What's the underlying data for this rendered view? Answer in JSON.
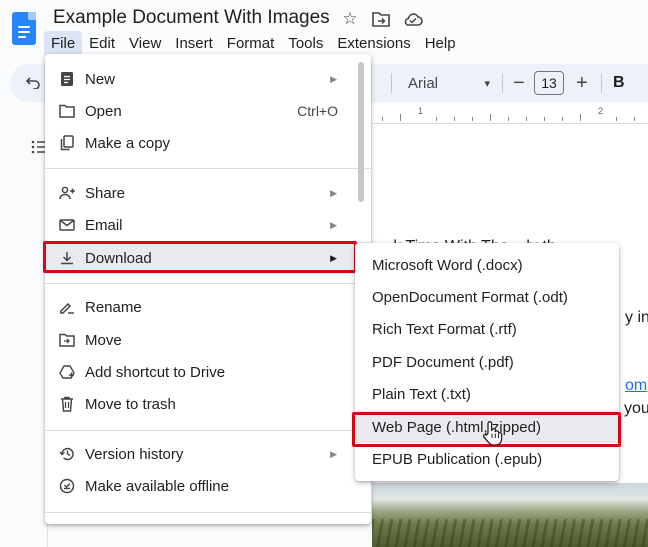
{
  "document": {
    "title": "Example Document With Images"
  },
  "menubar": [
    "File",
    "Edit",
    "View",
    "Insert",
    "Format",
    "Tools",
    "Extensions",
    "Help"
  ],
  "toolbar": {
    "font": "Arial",
    "font_size": "13",
    "minus": "−",
    "plus": "+",
    "bold": "B",
    "dropdown_arrow": "▾"
  },
  "ruler": {
    "numbers": [
      "1",
      "2"
    ]
  },
  "document_body": {
    "line1": "...k Time With The  ...ly th",
    "line2": "y in",
    "line3_link": "om",
    "line4": "you"
  },
  "file_menu": {
    "items": [
      {
        "label": "New",
        "icon": "new-document-icon",
        "submenu": true
      },
      {
        "label": "Open",
        "icon": "folder-icon",
        "shortcut": "Ctrl+O"
      },
      {
        "label": "Make a copy",
        "icon": "copy-icon"
      },
      {
        "label": "Share",
        "icon": "person-add-icon",
        "submenu": true
      },
      {
        "label": "Email",
        "icon": "email-icon",
        "submenu": true
      },
      {
        "label": "Download",
        "icon": "download-icon",
        "submenu": true,
        "highlighted": true
      },
      {
        "label": "Rename",
        "icon": "rename-icon"
      },
      {
        "label": "Move",
        "icon": "move-folder-icon"
      },
      {
        "label": "Add shortcut to Drive",
        "icon": "drive-shortcut-icon"
      },
      {
        "label": "Move to trash",
        "icon": "trash-icon"
      },
      {
        "label": "Version history",
        "icon": "history-icon",
        "submenu": true
      },
      {
        "label": "Make available offline",
        "icon": "offline-check-icon"
      }
    ]
  },
  "download_menu": {
    "items": [
      "Microsoft Word (.docx)",
      "OpenDocument Format (.odt)",
      "Rich Text Format (.rtf)",
      "PDF Document (.pdf)",
      "Plain Text (.txt)",
      "Web Page (.html, zipped)",
      "EPUB Publication (.epub)"
    ],
    "highlighted_index": 5
  },
  "colors": {
    "highlight_box": "#d40a19",
    "accent": "#2684fc",
    "link": "#1a73e8"
  }
}
